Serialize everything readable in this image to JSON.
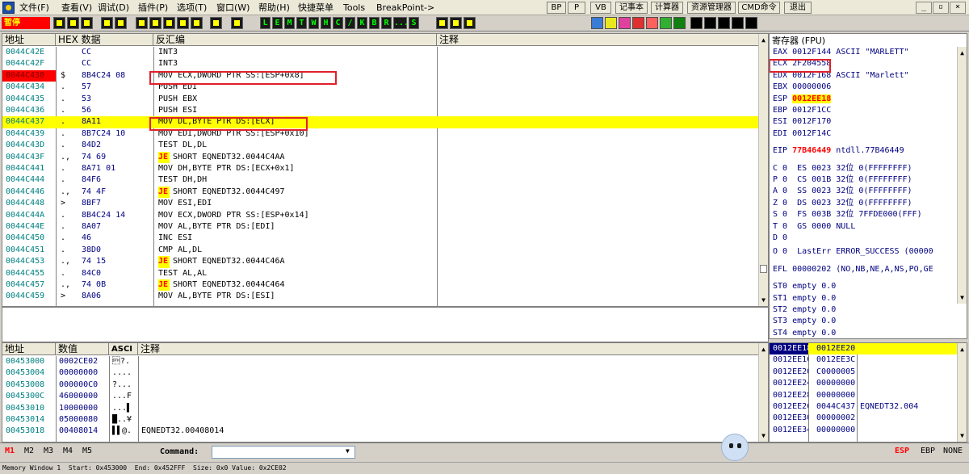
{
  "menu": [
    "文件(F)",
    "查看(V)",
    "调试(D)",
    "插件(P)",
    "选项(T)",
    "窗口(W)",
    "帮助(H)",
    "快捷菜单",
    "Tools",
    "BreakPoint->"
  ],
  "right_buttons": [
    "BP",
    "P",
    "VB",
    "记事本",
    "计算器",
    "资源管理器",
    "CMD命令",
    "退出"
  ],
  "status_label": "暂停",
  "toolbar_letters": [
    "L",
    "E",
    "M",
    "T",
    "W",
    "H",
    "C",
    "/",
    "K",
    "B",
    "R",
    "...",
    "S"
  ],
  "disasm": {
    "headers": [
      "地址",
      "HEX 数据",
      "反汇编",
      "注释"
    ],
    "rows": [
      {
        "addr": "0044C42E",
        "mark": "",
        "hex": "CC",
        "asm": "INT3",
        "jmp": ""
      },
      {
        "addr": "0044C42F",
        "mark": "",
        "hex": "CC",
        "asm": "INT3",
        "jmp": ""
      },
      {
        "addr": "0044C430",
        "mark": "$",
        "hex": "8B4C24 08",
        "asm": "MOV ECX,DWORD PTR SS:[ESP+0x8]",
        "jmp": ""
      },
      {
        "addr": "0044C434",
        "mark": ".",
        "hex": "57",
        "asm": "PUSH EDI",
        "jmp": ""
      },
      {
        "addr": "0044C435",
        "mark": ".",
        "hex": "53",
        "asm": "PUSH EBX",
        "jmp": ""
      },
      {
        "addr": "0044C436",
        "mark": ".",
        "hex": "56",
        "asm": "PUSH ESI",
        "jmp": ""
      },
      {
        "addr": "0044C437",
        "mark": ".",
        "hex": "8A11",
        "asm": "MOV DL,BYTE PTR DS:[ECX]",
        "jmp": ""
      },
      {
        "addr": "0044C439",
        "mark": ".",
        "hex": "8B7C24 10",
        "asm": "MOV EDI,DWORD PTR SS:[ESP+0x10]",
        "jmp": ""
      },
      {
        "addr": "0044C43D",
        "mark": ".",
        "hex": "84D2",
        "asm": "TEST DL,DL",
        "jmp": ""
      },
      {
        "addr": "0044C43F",
        "mark": ".,",
        "hex": "74 69",
        "asm": " SHORT EQNEDT32.0044C4AA",
        "jmp": "JE"
      },
      {
        "addr": "0044C441",
        "mark": ".",
        "hex": "8A71 01",
        "asm": "MOV DH,BYTE PTR DS:[ECX+0x1]",
        "jmp": ""
      },
      {
        "addr": "0044C444",
        "mark": ".",
        "hex": "84F6",
        "asm": "TEST DH,DH",
        "jmp": ""
      },
      {
        "addr": "0044C446",
        "mark": ".,",
        "hex": "74 4F",
        "asm": " SHORT EQNEDT32.0044C497",
        "jmp": "JE"
      },
      {
        "addr": "0044C448",
        "mark": ">",
        "hex": "8BF7",
        "asm": "MOV ESI,EDI",
        "jmp": ""
      },
      {
        "addr": "0044C44A",
        "mark": ".",
        "hex": "8B4C24 14",
        "asm": "MOV ECX,DWORD PTR SS:[ESP+0x14]",
        "jmp": ""
      },
      {
        "addr": "0044C44E",
        "mark": ".",
        "hex": "8A07",
        "asm": "MOV AL,BYTE PTR DS:[EDI]",
        "jmp": ""
      },
      {
        "addr": "0044C450",
        "mark": ".",
        "hex": "46",
        "asm": "INC ESI",
        "jmp": ""
      },
      {
        "addr": "0044C451",
        "mark": ".",
        "hex": "38D0",
        "asm": "CMP AL,DL",
        "jmp": ""
      },
      {
        "addr": "0044C453",
        "mark": ".,",
        "hex": "74 15",
        "asm": " SHORT EQNEDT32.0044C46A",
        "jmp": "JE"
      },
      {
        "addr": "0044C455",
        "mark": ".",
        "hex": "84C0",
        "asm": "TEST AL,AL",
        "jmp": ""
      },
      {
        "addr": "0044C457",
        "mark": ".,",
        "hex": "74 0B",
        "asm": " SHORT EQNEDT32.0044C464",
        "jmp": "JE"
      },
      {
        "addr": "0044C459",
        "mark": ">",
        "hex": "8A06",
        "asm": "MOV AL,BYTE PTR DS:[ESI]",
        "jmp": ""
      }
    ]
  },
  "registers": {
    "header": "寄存器 (FPU)",
    "lines": [
      {
        "name": "EAX",
        "val": "0012F144",
        "note": "ASCII \"MARLETT\""
      },
      {
        "name": "ECX",
        "val": "2F204558",
        "note": ""
      },
      {
        "name": "EDX",
        "val": "0012F168",
        "note": "ASCII \"Marlett\""
      },
      {
        "name": "EBX",
        "val": "00000006",
        "note": ""
      },
      {
        "name": "ESP",
        "val": "0012EE18",
        "note": ""
      },
      {
        "name": "EBP",
        "val": "0012F1CC",
        "note": ""
      },
      {
        "name": "ESI",
        "val": "0012F170",
        "note": ""
      },
      {
        "name": "EDI",
        "val": "0012F14C",
        "note": ""
      }
    ],
    "eip": {
      "name": "EIP",
      "val": "77B46449",
      "note": "ntdll.77B46449"
    },
    "flags": [
      "C 0  ES 0023 32位 0(FFFFFFFF)",
      "P 0  CS 001B 32位 0(FFFFFFFF)",
      "A 0  SS 0023 32位 0(FFFFFFFF)",
      "Z 0  DS 0023 32位 0(FFFFFFFF)",
      "S 0  FS 003B 32位 7FFDE000(FFF)",
      "T 0  GS 0000 NULL",
      "D 0",
      "O 0  LastErr ERROR_SUCCESS (00000"
    ],
    "efl": "EFL 00000202 (NO,NB,NE,A,NS,PO,GE",
    "fpu": [
      "ST0 empty 0.0",
      "ST1 empty 0.0",
      "ST2 empty 0.0",
      "ST3 empty 0.0",
      "ST4 empty 0.0"
    ]
  },
  "memory": {
    "headers": [
      "地址",
      "数值",
      "ASCI",
      "注释"
    ],
    "rows": [
      {
        "addr": "00453000",
        "val": "0002CE02",
        "ascii": "\u0002?.",
        "note": ""
      },
      {
        "addr": "00453004",
        "val": "00000000",
        "ascii": "....",
        "note": ""
      },
      {
        "addr": "00453008",
        "val": "000000C0",
        "ascii": "?...",
        "note": ""
      },
      {
        "addr": "0045300C",
        "val": "46000000",
        "ascii": "...F",
        "note": ""
      },
      {
        "addr": "00453010",
        "val": "10000000",
        "ascii": "...▌",
        "note": ""
      },
      {
        "addr": "00453014",
        "val": "05000080",
        "ascii": "█..¥",
        "note": ""
      },
      {
        "addr": "00453018",
        "val": "00408014",
        "ascii": "▌▌@.",
        "note": "EQNEDT32.00408014"
      }
    ]
  },
  "stack": {
    "rows": [
      {
        "addr": "0012EE18",
        "val": "0012EE20",
        "note": ""
      },
      {
        "addr": "0012EE1C",
        "val": "0012EE3C",
        "note": ""
      },
      {
        "addr": "0012EE20",
        "val": "C0000005",
        "note": ""
      },
      {
        "addr": "0012EE24",
        "val": "00000000",
        "note": ""
      },
      {
        "addr": "0012EE28",
        "val": "00000000",
        "note": ""
      },
      {
        "addr": "0012EE2C",
        "val": "0044C437",
        "note": "EQNEDT32.004"
      },
      {
        "addr": "0012EE30",
        "val": "00000002",
        "note": ""
      },
      {
        "addr": "0012EE34",
        "val": "00000000",
        "note": ""
      }
    ]
  },
  "cmdbar": {
    "m_buttons": [
      "M1",
      "M2",
      "M3",
      "M4",
      "M5"
    ],
    "command_label": "Command:",
    "command_value": "",
    "reg_buttons": [
      "ESP",
      "EBP",
      "NONE"
    ]
  },
  "statusbar": "Memory Window 1  Start: 0x453000  End: 0x452FFF  Size: 0x0 Value: 0x2CE02",
  "colors": {
    "highlight": "#ffff00",
    "accent_red": "#e0202a",
    "address_teal": "#008080"
  }
}
